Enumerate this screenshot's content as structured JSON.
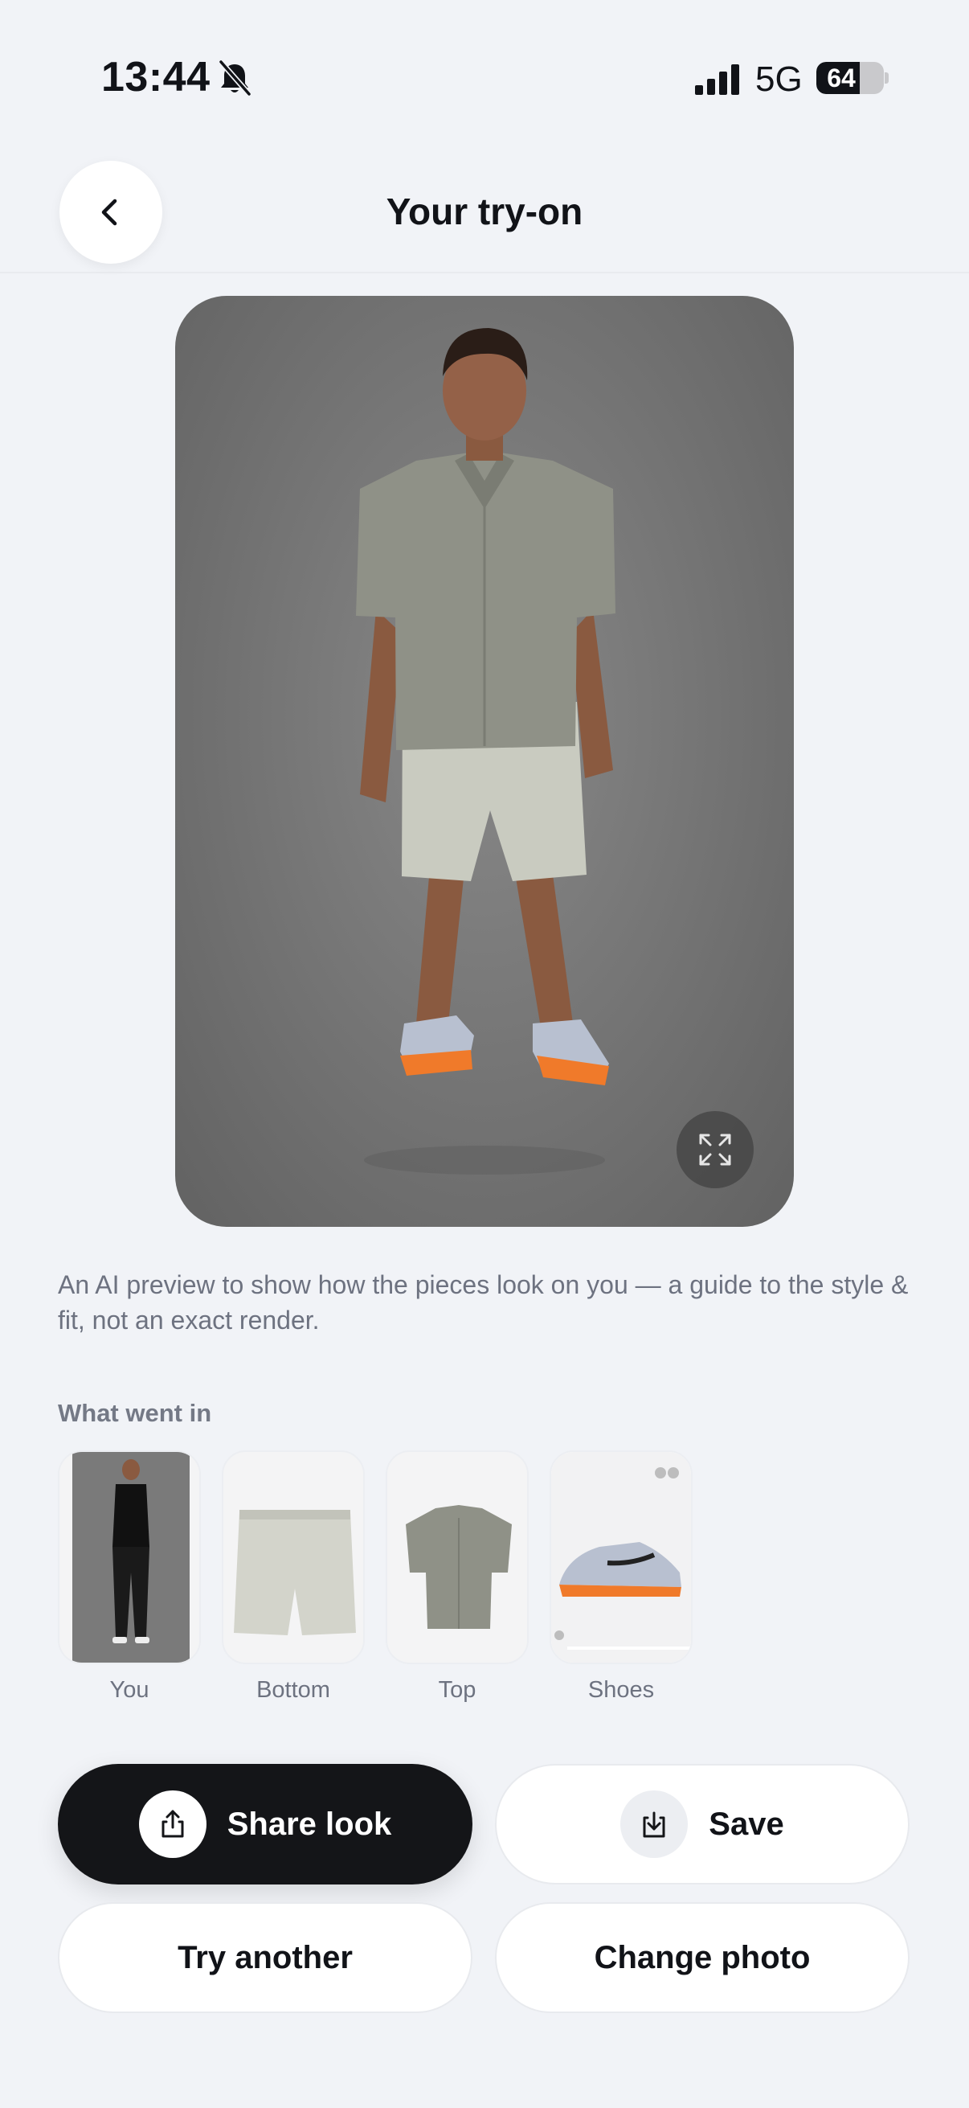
{
  "status_bar": {
    "time": "13:44",
    "network": "5G",
    "battery_percent": 64,
    "battery_label": "64"
  },
  "header": {
    "title": "Your try-on",
    "back_icon": "chevron-left-icon"
  },
  "preview": {
    "expand_icon": "expand-icon"
  },
  "disclaimer": "An AI preview to show how the pieces look on you — a guide to the style & fit, not an exact render.",
  "inputs": {
    "title": "What went in",
    "items": [
      {
        "label": "You"
      },
      {
        "label": "Bottom"
      },
      {
        "label": "Top"
      },
      {
        "label": "Shoes"
      }
    ]
  },
  "actions": {
    "share_label": "Share look",
    "save_label": "Save",
    "try_another_label": "Try another",
    "change_photo_label": "Change photo"
  },
  "colors": {
    "background": "#f1f3f7",
    "primary_button": "#141518",
    "shoe_accent": "#f07a2a"
  }
}
